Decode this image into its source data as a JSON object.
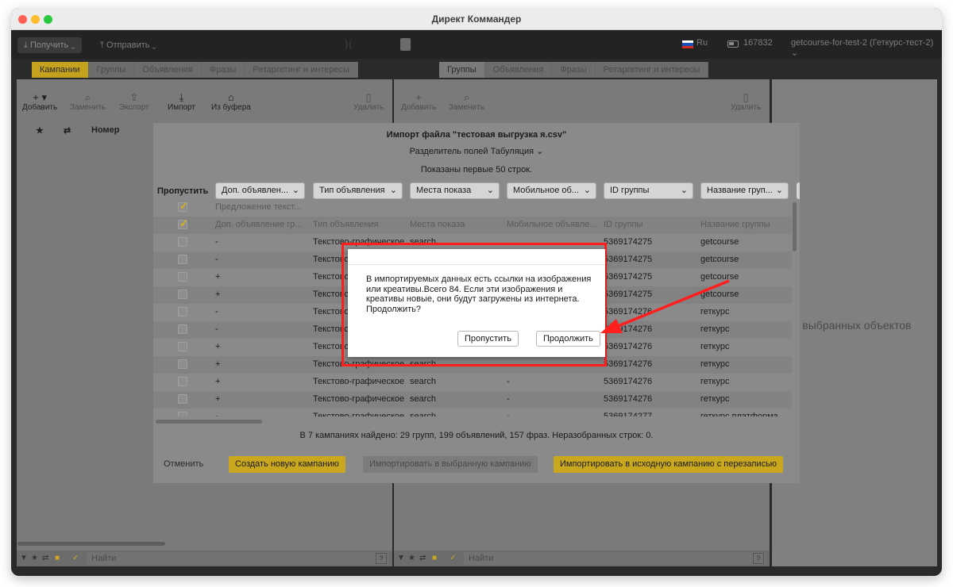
{
  "window": {
    "title": "Директ Коммандер"
  },
  "topbar": {
    "get_label": "Получить",
    "send_label": "Отправить",
    "lang": "Ru",
    "balance": "167832",
    "account": "getcourse-for-test-2 (Геткурс-тест-2)"
  },
  "left_panel": {
    "tabs": [
      "Кампании",
      "Группы",
      "Объявления",
      "Фразы",
      "Ретаргетинг и интересы"
    ],
    "tools": {
      "add": "Добавить",
      "replace": "Заменить",
      "export": "Экспорт",
      "import": "Импорт",
      "from_buffer": "Из буфера",
      "delete": "Удалить"
    },
    "col_number": "Номер",
    "find_placeholder": "Найти"
  },
  "mid_panel": {
    "tabs": [
      "Группы",
      "Объявления",
      "Фразы",
      "Ретаргетинг и интересы"
    ],
    "tools": {
      "add": "Добавить",
      "replace": "Заменить",
      "delete": "Удалить"
    },
    "find_placeholder": "Найти"
  },
  "right_panel": {
    "empty_text": "т выбранных объектов"
  },
  "import_dialog": {
    "title": "Импорт файла \"тестовая выгрузка я.csv\"",
    "separator_label": "Разделитель полей",
    "separator_value": "Табуляция",
    "shown_rows": "Показаны первые 50 строк.",
    "skip_label": "Пропустить",
    "column_selects": [
      "Доп. объявлен...",
      "Тип объявления",
      "Места показа",
      "Мобильное об...",
      "ID группы",
      "Название груп..."
    ],
    "rows": [
      {
        "checked": true,
        "muted": true,
        "c": [
          "Предложение текст...",
          "",
          "",
          "",
          "",
          ""
        ]
      },
      {
        "checked": true,
        "muted": true,
        "c": [
          "Доп. объявление гр...",
          "Тип объявления",
          "Места показа",
          "Мобильное объявле...",
          "ID группы",
          "Название группы"
        ]
      },
      {
        "checked": false,
        "muted": false,
        "c": [
          "-",
          "Текстово-графическое",
          "search",
          "",
          "5369174275",
          "getcourse"
        ]
      },
      {
        "checked": false,
        "muted": false,
        "c": [
          "-",
          "Текстово-графическое",
          "search",
          "",
          "5369174275",
          "getcourse"
        ]
      },
      {
        "checked": false,
        "muted": false,
        "c": [
          "+",
          "Текстово-графическое",
          "search",
          "",
          "5369174275",
          "getcourse"
        ]
      },
      {
        "checked": false,
        "muted": false,
        "c": [
          "+",
          "Текстово-графическое",
          "search",
          "",
          "5369174275",
          "getcourse"
        ]
      },
      {
        "checked": false,
        "muted": false,
        "c": [
          "-",
          "Текстово-графическое",
          "search",
          "",
          "5369174276",
          "геткурс"
        ]
      },
      {
        "checked": false,
        "muted": false,
        "c": [
          "-",
          "Текстово-графическое",
          "search",
          "",
          "5369174276",
          "геткурс"
        ]
      },
      {
        "checked": false,
        "muted": false,
        "c": [
          "+",
          "Текстово-графическое",
          "search",
          "",
          "5369174276",
          "геткурс"
        ]
      },
      {
        "checked": false,
        "muted": false,
        "c": [
          "+",
          "Текстово-графическое",
          "search",
          "",
          "5369174276",
          "геткурс"
        ]
      },
      {
        "checked": false,
        "muted": false,
        "c": [
          "+",
          "Текстово-графическое",
          "search",
          "-",
          "5369174276",
          "геткурс"
        ]
      },
      {
        "checked": false,
        "muted": false,
        "c": [
          "+",
          "Текстово-графическое",
          "search",
          "-",
          "5369174276",
          "геткурс"
        ]
      },
      {
        "checked": false,
        "muted": false,
        "c": [
          "-",
          "Текстово-графическое",
          "search",
          "-",
          "5369174277",
          "геткурс платформа"
        ]
      }
    ],
    "summary": "В 7 кампаниях найдено: 29 групп, 199 объявлений, 157 фраз. Неразобранных строк: 0.",
    "cancel_label": "Отменить",
    "create_campaign_label": "Создать новую кампанию",
    "import_selected_label": "Импортировать в выбранную кампанию",
    "import_overwrite_label": "Импортировать в исходную кампанию с перезаписью"
  },
  "alert": {
    "message": "В импортируемых данных есть ссылки на изображения или креативы.Всего 84. Если эти изображения и креативы новые, они будут загружены из интернета. Продолжить?",
    "skip_label": "Пропустить",
    "continue_label": "Продолжить"
  },
  "colors": {
    "accent": "#c9a820",
    "highlight": "#ff1f1f",
    "flag": [
      "#ffffff",
      "#1f4fb8",
      "#d52b1e"
    ]
  }
}
